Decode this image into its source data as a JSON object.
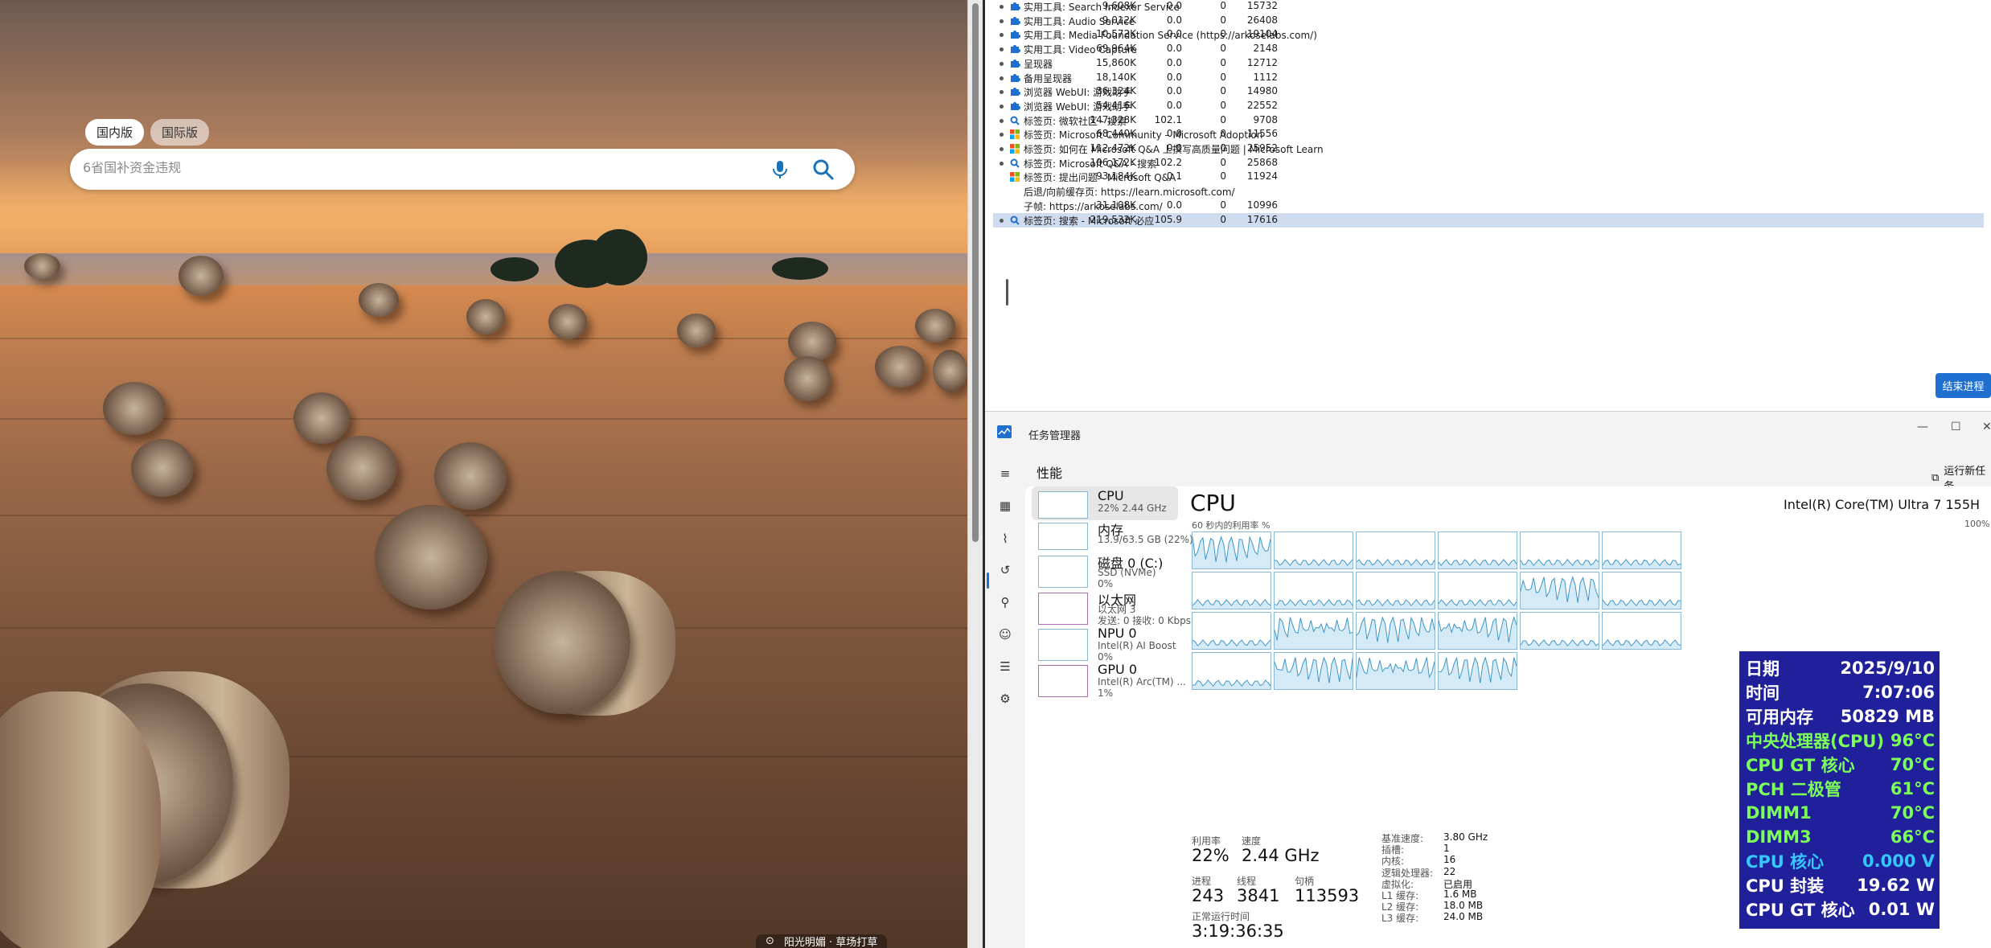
{
  "browser": {
    "tab_domestic": "国内版",
    "tab_international": "国际版",
    "search_placeholder": "6省国补资金违规",
    "bottom_info": "阳光明媚 · 草场打草"
  },
  "process_list": {
    "rows": [
      {
        "name": "实用工具: Search Indexer Service",
        "memory": "9,608K",
        "cpu": "0.0",
        "net": "0",
        "pid": "15732",
        "icon": "puzzle-icon"
      },
      {
        "name": "实用工具: Audio Service",
        "memory": "9,012K",
        "cpu": "0.0",
        "net": "0",
        "pid": "26408",
        "icon": "puzzle-icon"
      },
      {
        "name": "实用工具: Media Foundation Service (https://arkoselabs.com/)",
        "memory": "10,572K",
        "cpu": "0.0",
        "net": "0",
        "pid": "19104",
        "icon": "puzzle-icon"
      },
      {
        "name": "实用工具: Video Capture",
        "memory": "69,964K",
        "cpu": "0.0",
        "net": "0",
        "pid": "2148",
        "icon": "puzzle-icon"
      },
      {
        "name": "呈现器",
        "memory": "15,860K",
        "cpu": "0.0",
        "net": "0",
        "pid": "12712",
        "icon": "puzzle-icon"
      },
      {
        "name": "备用呈现器",
        "memory": "18,140K",
        "cpu": "0.0",
        "net": "0",
        "pid": "1112",
        "icon": "puzzle-icon"
      },
      {
        "name": "浏览器 WebUI: 游戏助手",
        "memory": "36,324K",
        "cpu": "0.0",
        "net": "0",
        "pid": "14980",
        "icon": "puzzle-icon"
      },
      {
        "name": "浏览器 WebUI: 游戏助手",
        "memory": "54,416K",
        "cpu": "0.0",
        "net": "0",
        "pid": "22552",
        "icon": "puzzle-icon"
      },
      {
        "name": "标签页: 微软社区 - 搜索",
        "memory": "147,328K",
        "cpu": "102.1",
        "net": "0",
        "pid": "9708",
        "icon": "search-icon"
      },
      {
        "name": "标签页: Microsoft Community – Microsoft Adoption",
        "memory": "68,440K",
        "cpu": "0.0",
        "net": "0",
        "pid": "11556",
        "icon": "microsoft-logo-icon"
      },
      {
        "name": "标签页: 如何在 Microsoft Q&A 上撰写高质量问题 | Microsoft Learn",
        "memory": "112,472K",
        "cpu": "0.0",
        "net": "0",
        "pid": "25952",
        "icon": "microsoft-logo-icon"
      },
      {
        "name": "标签页: Microsoft Q&A - 搜索",
        "memory": "106,172K",
        "cpu": "102.2",
        "net": "0",
        "pid": "25868",
        "icon": "search-icon"
      },
      {
        "name": "标签页: 提出问题 - Microsoft Q&A",
        "memory": "93,184K",
        "cpu": "0.1",
        "net": "0",
        "pid": "11924",
        "icon": "microsoft-logo-icon"
      },
      {
        "name": "后退/向前缓存页: https://learn.microsoft.com/",
        "memory": "",
        "cpu": "",
        "net": "",
        "pid": "",
        "icon": ""
      },
      {
        "name": "子帧: https://arkoselabs.com/",
        "memory": "31,108K",
        "cpu": "0.0",
        "net": "0",
        "pid": "10996",
        "icon": ""
      },
      {
        "name": "标签页: 搜索 - Microsoft 必应",
        "memory": "219,532K",
        "cpu": "105.9",
        "net": "0",
        "pid": "17616",
        "icon": "search-icon"
      }
    ],
    "end_button": "结束进程"
  },
  "task_manager": {
    "title": "任务管理器",
    "section": "性能",
    "run_new_task": "运行新任务",
    "resources": [
      {
        "name": "CPU",
        "sub1": "22% 2.44 GHz",
        "sub2": "",
        "sub3": ""
      },
      {
        "name": "内存",
        "sub1": "13.9/63.5 GB (22%)",
        "sub2": "",
        "sub3": ""
      },
      {
        "name": "磁盘 0 (C:)",
        "sub1": "SSD (NVMe)",
        "sub2": "0%",
        "sub3": ""
      },
      {
        "name": "以太网",
        "sub1": "以太网 3",
        "sub2": "发送: 0 接收: 0 Kbps",
        "sub3": ""
      },
      {
        "name": "NPU 0",
        "sub1": "Intel(R) AI Boost",
        "sub2": "0%",
        "sub3": ""
      },
      {
        "name": "GPU 0",
        "sub1": "Intel(R) Arc(TM) ...",
        "sub2": "1%",
        "sub3": ""
      }
    ],
    "cpu_title": "CPU",
    "cpu_model": "Intel(R) Core(TM) Ultra 7 155H",
    "util_caption": "60 秒内的利用率 %",
    "util_max": "100%",
    "stats": {
      "util_label": "利用率",
      "util_value": "22%",
      "speed_label": "速度",
      "speed_value": "2.44 GHz",
      "proc_label": "进程",
      "proc_value": "243",
      "thread_label": "线程",
      "thread_value": "3841",
      "handle_label": "句柄",
      "handle_value": "113593",
      "uptime_label": "正常运行时间",
      "uptime_value": "3:19:36:35"
    },
    "specs": [
      {
        "label": "基准速度:",
        "value": "3.80 GHz"
      },
      {
        "label": "插槽:",
        "value": "1"
      },
      {
        "label": "内核:",
        "value": "16"
      },
      {
        "label": "逻辑处理器:",
        "value": "22"
      },
      {
        "label": "虚拟化:",
        "value": "已启用"
      },
      {
        "label": "L1 缓存:",
        "value": "1.6 MB"
      },
      {
        "label": "L2 缓存:",
        "value": "18.0 MB"
      },
      {
        "label": "L3 缓存:",
        "value": "24.0 MB"
      }
    ]
  },
  "hw_monitor": {
    "rows": [
      {
        "label": "日期",
        "value": "2025/9/10",
        "color": "#ffffff"
      },
      {
        "label": "时间",
        "value": "7:07:06",
        "color": "#ffffff"
      },
      {
        "label": "可用内存",
        "value": "50829 MB",
        "color": "#ffffff"
      },
      {
        "label": "中央处理器(CPU)",
        "value": "96°C",
        "color": "#7dff5a"
      },
      {
        "label": "CPU GT 核心",
        "value": "70°C",
        "color": "#7dff5a"
      },
      {
        "label": "PCH 二极管",
        "value": "61°C",
        "color": "#7dff5a"
      },
      {
        "label": "DIMM1",
        "value": "70°C",
        "color": "#7dff5a"
      },
      {
        "label": "DIMM3",
        "value": "66°C",
        "color": "#7dff5a"
      },
      {
        "label": "CPU 核心",
        "value": "0.000 V",
        "color": "#35c8ff"
      },
      {
        "label": "CPU 封装",
        "value": "19.62 W",
        "color": "#ffffff"
      },
      {
        "label": "CPU GT 核心",
        "value": "0.01 W",
        "color": "#ffffff"
      }
    ]
  }
}
